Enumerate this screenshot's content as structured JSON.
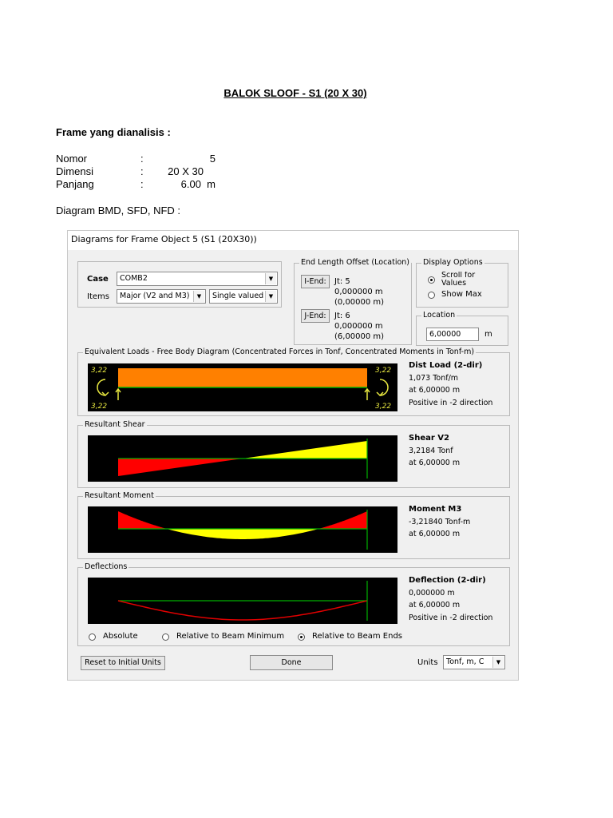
{
  "document": {
    "title": "BALOK SLOOF - S1 (20 X 30)",
    "section_title": "Frame yang dianalisis :",
    "info": [
      {
        "label": "Nomor",
        "colon": ":",
        "value": "5"
      },
      {
        "label": "Dimensi",
        "colon": ":",
        "value": "20 X 30"
      },
      {
        "label": "Panjang",
        "colon": ":",
        "value": "6.00  m"
      }
    ],
    "diagram_caption": "Diagram BMD, SFD, NFD :"
  },
  "dialog": {
    "title": "Diagrams for Frame Object 5  (S1 (20X30))",
    "case_label": "Case",
    "case_value": "COMB2",
    "items_label": "Items",
    "items_value": "Major (V2 and M3)",
    "items_mode": "Single valued",
    "end_offset": {
      "group_label": "End Length Offset (Location)",
      "i_end_button": "I-End:",
      "i_jt": "Jt:  5",
      "i_offset": "0,000000 m",
      "i_location": "(0,00000 m)",
      "j_end_button": "J-End:",
      "j_jt": "Jt:  6",
      "j_offset": "0,000000 m",
      "j_location": "(6,00000 m)"
    },
    "display_options": {
      "group_label": "Display Options",
      "opt_scroll": "Scroll for Values",
      "opt_showmax": "Show Max"
    },
    "location": {
      "group_label": "Location",
      "value": "6,00000",
      "unit": "m"
    },
    "panels": {
      "equivalent": {
        "label": "Equivalent Loads - Free Body Diagram  (Concentrated Forces in Tonf, Concentrated Moments in Tonf-m)",
        "heading": "Dist Load (2-dir)",
        "line1": "1,073 Tonf/m",
        "line2": "at 6,00000 m",
        "line3": "Positive in -2 direction",
        "end_labels": [
          "3,22",
          "3,22",
          "3,22",
          "3,22"
        ]
      },
      "shear": {
        "label": "Resultant Shear",
        "heading": "Shear V2",
        "line1": "3,2184 Tonf",
        "line2": "at 6,00000 m"
      },
      "moment": {
        "label": "Resultant Moment",
        "heading": "Moment M3",
        "line1": "-3,21840 Tonf-m",
        "line2": "at 6,00000 m"
      },
      "deflection": {
        "label": "Deflections",
        "heading": "Deflection (2-dir)",
        "line1": "0,000000 m",
        "line2": "at 6,00000 m",
        "line3": "Positive in -2 direction",
        "opt_absolute": "Absolute",
        "opt_rel_min": "Relative to Beam Minimum",
        "opt_rel_ends": "Relative to Beam Ends"
      }
    },
    "reset_button": "Reset to Initial Units",
    "done_button": "Done",
    "units_label": "Units",
    "units_value": "Tonf, m, C"
  },
  "colors": {
    "plot_background": "#000000",
    "load_fill": "#ff8000",
    "negative_fill": "#ff0000",
    "positive_fill": "#ffff00",
    "axis_line": "#00b000",
    "deflection_curve": "#e00000"
  }
}
